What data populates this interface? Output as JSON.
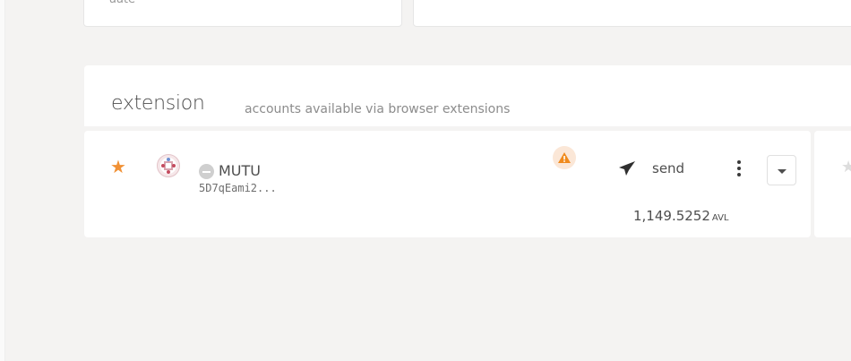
{
  "top": {
    "left_card_clipped_text": "aate"
  },
  "section": {
    "title": "extension",
    "subtitle": "accounts available via browser extensions"
  },
  "account": {
    "name": "MUTU",
    "address": "5D7qEami2...",
    "send_label": "send",
    "balance_value": "1,149.5252",
    "balance_unit": "AVL",
    "favorite": true
  },
  "colors": {
    "star": "#f19135",
    "warning": "#f08a1c",
    "background": "#f4f3f2"
  },
  "icons": {
    "favorite": "star-icon",
    "identity": "identicon-icon",
    "status": "minus-circle-icon",
    "warning": "warning-icon",
    "send": "paper-plane-icon",
    "menu": "kebab-menu-icon",
    "expand": "caret-down-icon"
  }
}
